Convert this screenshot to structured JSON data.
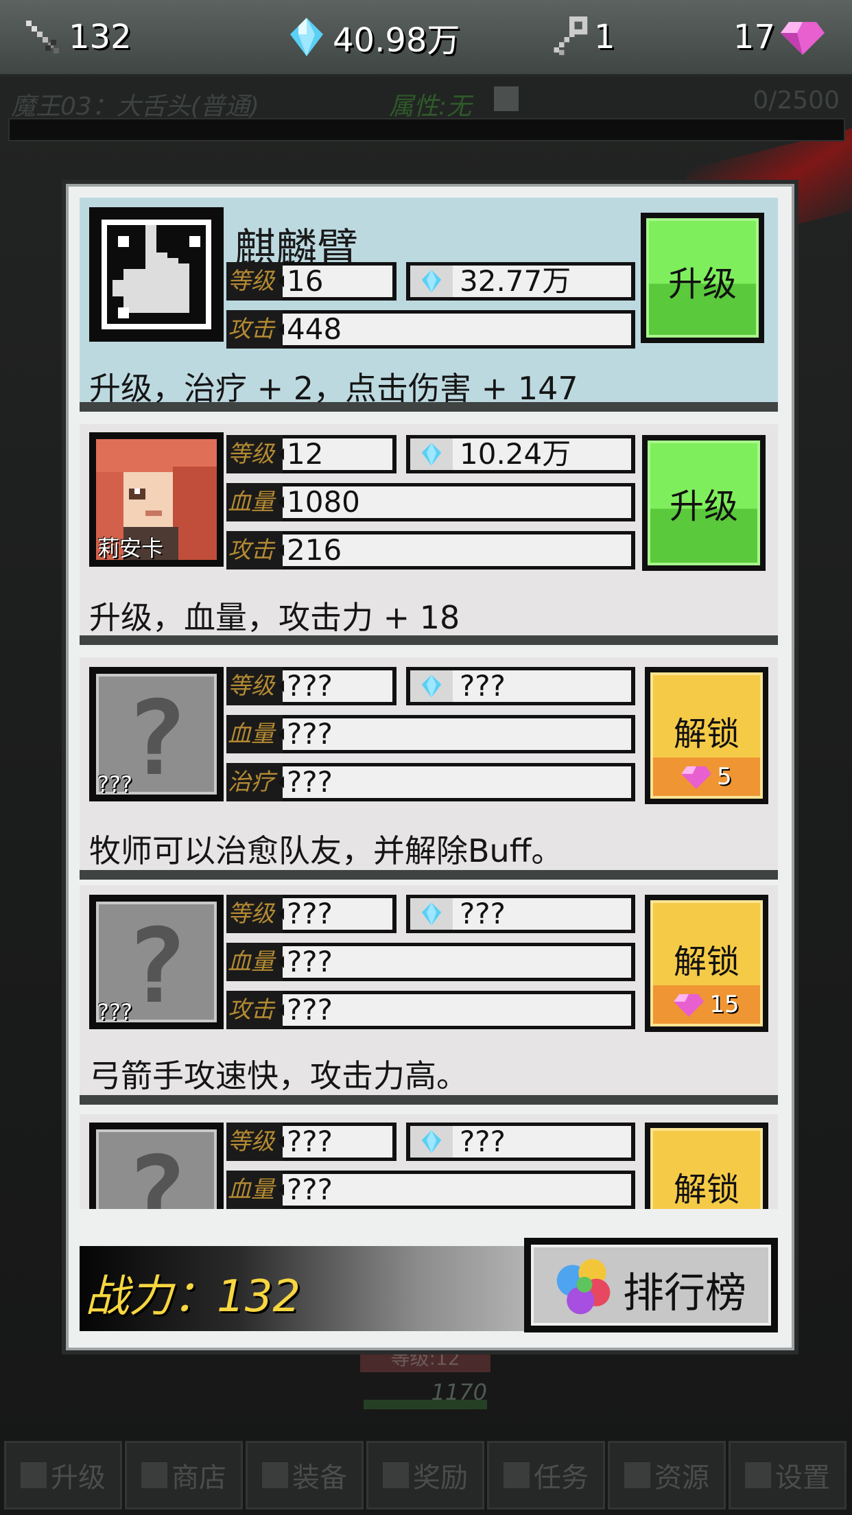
{
  "topbar": {
    "dps": "132",
    "crystals": "40.98万",
    "keys": "1",
    "gems": "17"
  },
  "boss": {
    "name": "魔王03：大舌头(普通)",
    "attribute": "属性:无",
    "hp": "0/2500"
  },
  "cards": [
    {
      "title": "麒麟臂",
      "level_label": "等级",
      "level": "16",
      "cost": "32.77万",
      "row2_label": "攻击",
      "row2": "448",
      "button": "升级",
      "desc": "升级，治疗 + 2，点击伤害 + 147"
    },
    {
      "portrait_name": "莉安卡",
      "level_label": "等级",
      "level": "12",
      "cost": "10.24万",
      "row2_label": "血量",
      "row2": "1080",
      "row3_label": "攻击",
      "row3": "216",
      "button": "升级",
      "desc": "升级，血量，攻击力 + 18"
    },
    {
      "portrait_name": "???",
      "level_label": "等级",
      "level": "???",
      "cost": "???",
      "row2_label": "血量",
      "row2": "???",
      "row3_label": "治疗",
      "row3": "???",
      "button": "解锁",
      "price": "5",
      "desc": "牧师可以治愈队友，并解除Buff。"
    },
    {
      "portrait_name": "???",
      "level_label": "等级",
      "level": "???",
      "cost": "???",
      "row2_label": "血量",
      "row2": "???",
      "row3_label": "攻击",
      "row3": "???",
      "button": "解锁",
      "price": "15",
      "desc": "弓箭手攻速快，攻击力高。"
    },
    {
      "level_label": "等级",
      "level": "???",
      "cost": "???",
      "row2_label": "血量",
      "row2": "???",
      "button": "解锁"
    }
  ],
  "footer": {
    "power": "战力：132",
    "ranking": "排行榜"
  },
  "behind": {
    "level": "等级:12",
    "hp": "1170"
  },
  "nav": [
    "升级",
    "商店",
    "装备",
    "奖励",
    "任务",
    "资源",
    "设置"
  ],
  "colors": {
    "upgrade_green": "#7fee5c",
    "unlock_yellow": "#f5ca46",
    "price_orange": "#ef9533",
    "power_gold": "#f7d640",
    "label_gold": "#b48a33"
  }
}
